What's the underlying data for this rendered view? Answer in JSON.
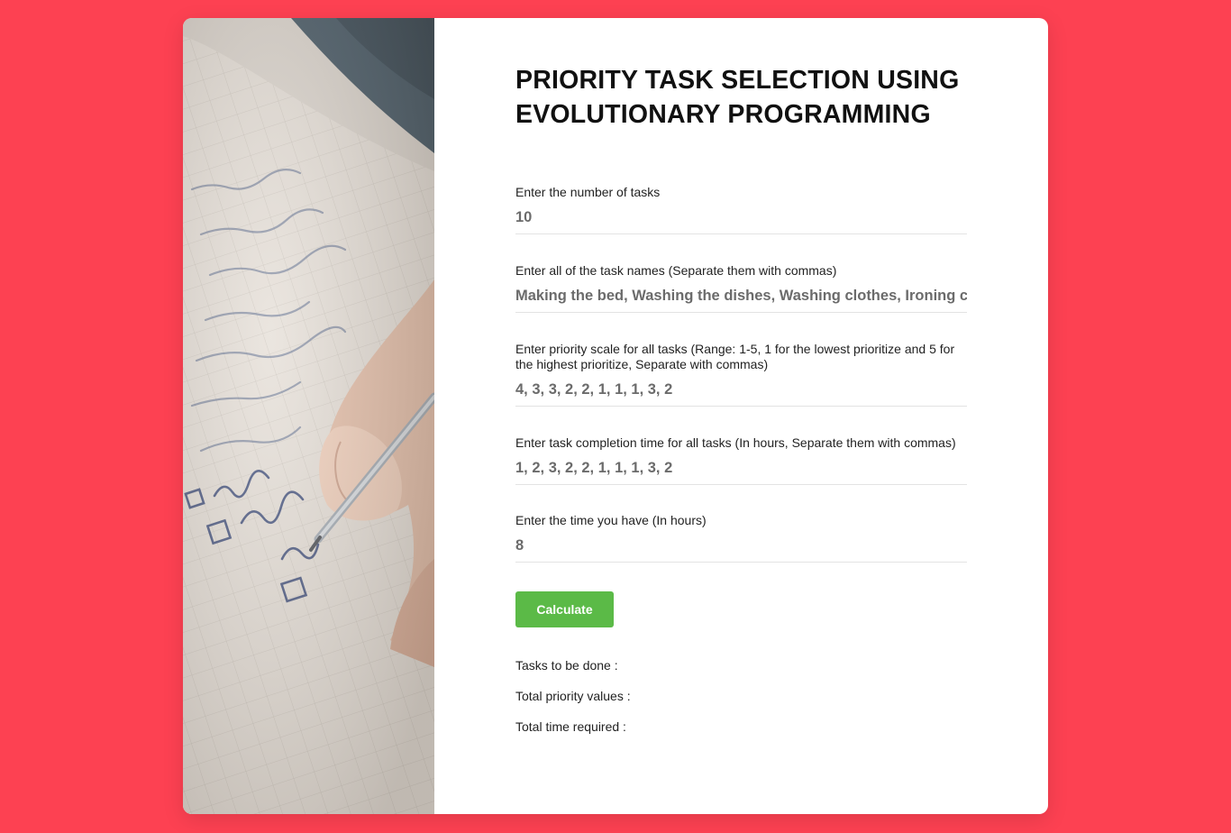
{
  "colors": {
    "background": "#fd4152",
    "card": "#ffffff",
    "button": "#5bba47",
    "title_text": "#111111",
    "input_text": "#6b6b6b"
  },
  "hero_image": {
    "description_icon": "notepad-checklist-photo"
  },
  "form": {
    "title": "PRIORITY TASK SELECTION USING EVOLUTIONARY PROGRAMMING",
    "fields": [
      {
        "label": "Enter the number of tasks",
        "value": "10"
      },
      {
        "label": "Enter all of the task names (Separate them with commas)",
        "value": "Making the bed, Washing the dishes, Washing clothes, Ironing clothes,"
      },
      {
        "label": "Enter priority scale for all tasks (Range: 1-5, 1 for the lowest prioritize and 5 for the highest prioritize, Separate with commas)",
        "value": "4, 3, 3, 2, 2, 1, 1, 1, 3, 2"
      },
      {
        "label": "Enter task completion time for all tasks (In hours, Separate them with commas)",
        "value": "1, 2, 3, 2, 2, 1, 1, 1, 3, 2"
      },
      {
        "label": "Enter the time you have (In hours)",
        "value": "8"
      }
    ],
    "submit_label": "Calculate"
  },
  "results": {
    "tasks_label": "Tasks to be done :",
    "priority_label": "Total priority values :",
    "time_label": "Total time required :"
  }
}
